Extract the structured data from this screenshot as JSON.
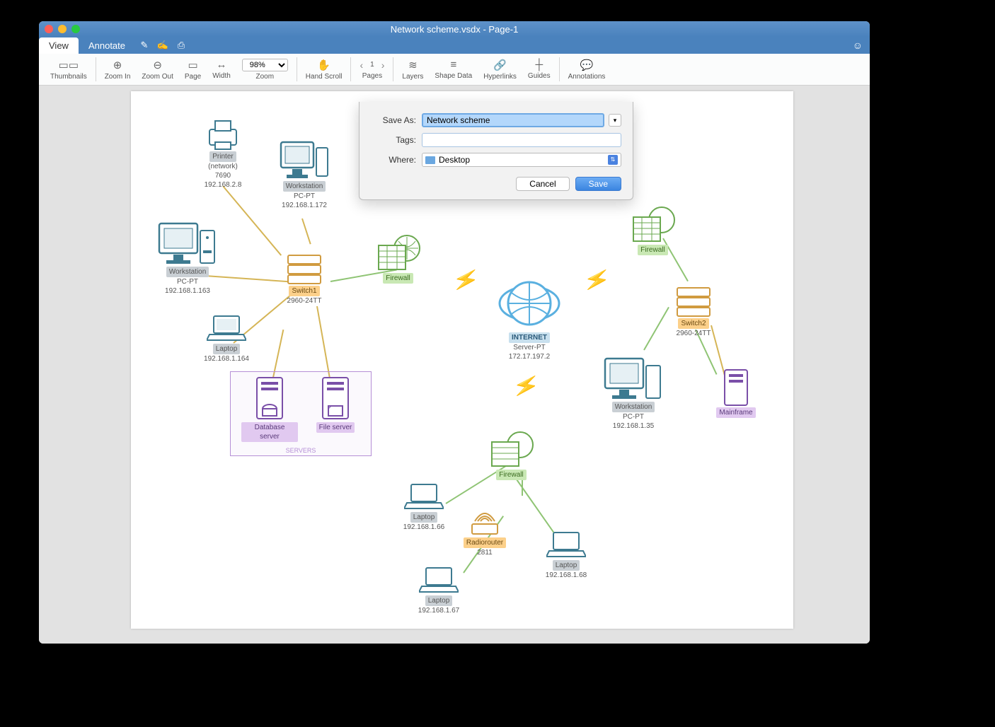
{
  "title": "Network scheme.vsdx - Page-1",
  "tabs": {
    "view": "View",
    "annotate": "Annotate"
  },
  "toolbar": {
    "thumbnails": "Thumbnails",
    "zoomin": "Zoom In",
    "zoomout": "Zoom Out",
    "page": "Page",
    "width": "Width",
    "zoom_pct": "98%",
    "zoom": "Zoom",
    "handscroll": "Hand Scroll",
    "cur_page": "1",
    "pages": "Pages",
    "layers": "Layers",
    "shapedata": "Shape Data",
    "hyperlinks": "Hyperlinks",
    "guides": "Guides",
    "annotations": "Annotations"
  },
  "dialog": {
    "saveas_label": "Save As:",
    "saveas_value": "Network scheme",
    "tags_label": "Tags:",
    "tags_value": "",
    "where_label": "Where:",
    "where_value": "Desktop",
    "cancel": "Cancel",
    "save": "Save"
  },
  "nodes": {
    "printer": {
      "name": "Printer",
      "sub": "(network)",
      "id": "7690",
      "ip": "192.168.2.8"
    },
    "ws1": {
      "name": "Workstation",
      "sub": "PC-PT",
      "ip": "192.168.1.172"
    },
    "ws2": {
      "name": "Workstation",
      "sub": "PC-PT",
      "ip": "192.168.1.163"
    },
    "switch1": {
      "name": "Switch1",
      "model": "2960-24TT"
    },
    "fw1": {
      "name": "Firewall"
    },
    "laptop1": {
      "name": "Laptop",
      "ip": "192.168.1.164"
    },
    "db": {
      "name": "Database server"
    },
    "file": {
      "name": "File server"
    },
    "servers": "SERVERS",
    "internet": {
      "name": "INTERNET",
      "sub": "Server-PT",
      "ip": "172.17.197.2"
    },
    "fw2": {
      "name": "Firewall"
    },
    "switch2": {
      "name": "Switch2",
      "model": "2960-24TT"
    },
    "ws3": {
      "name": "Workstation",
      "sub": "PC-PT",
      "ip": "192.168.1.35"
    },
    "mainframe": {
      "name": "Mainframe"
    },
    "fw3": {
      "name": "Firewall"
    },
    "laptop2": {
      "name": "Laptop",
      "ip": "192.168.1.66"
    },
    "radio": {
      "name": "Radiorouter",
      "model": "2811"
    },
    "laptop3": {
      "name": "Laptop",
      "ip": "192.168.1.67"
    },
    "laptop4": {
      "name": "Laptop",
      "ip": "192.168.1.68"
    }
  }
}
